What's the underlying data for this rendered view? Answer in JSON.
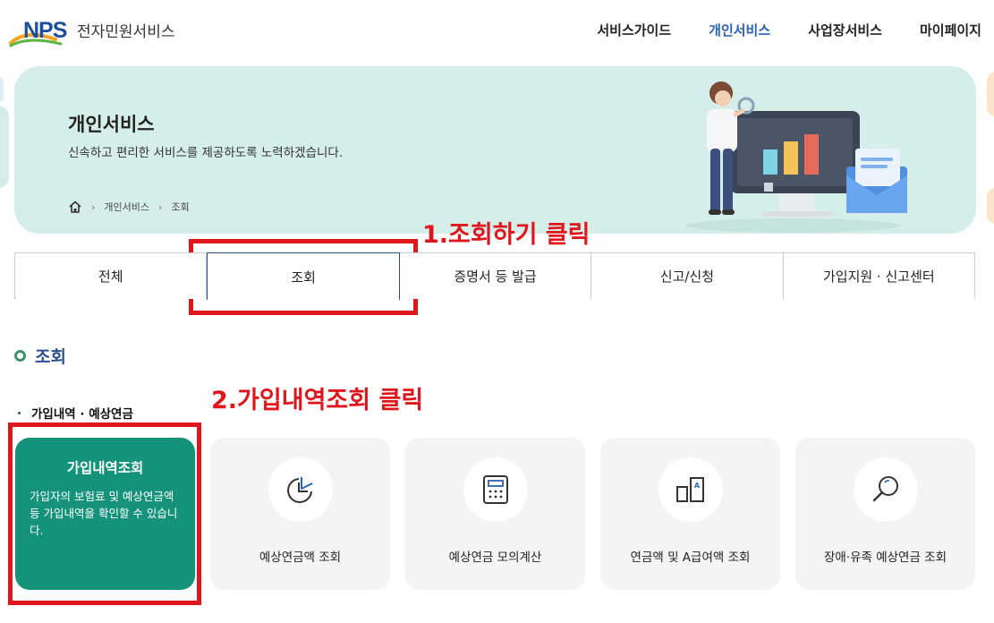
{
  "header": {
    "logo_text": "NPS",
    "site_name": "전자민원서비스",
    "nav": [
      {
        "label": "서비스가이드"
      },
      {
        "label": "개인서비스"
      },
      {
        "label": "사업장서비스"
      },
      {
        "label": "마이페이지"
      }
    ]
  },
  "banner": {
    "title": "개인서비스",
    "subtitle": "신속하고 편리한 서비스를 제공하도록 노력하겠습니다.",
    "breadcrumb": [
      "개인서비스",
      "조회"
    ]
  },
  "annotations": {
    "step1": "1.조회하기 클릭",
    "step2": "2.가입내역조회 클릭"
  },
  "tabs": [
    {
      "label": "전체"
    },
    {
      "label": "조회"
    },
    {
      "label": "증명서 등 발급"
    },
    {
      "label": "신고/신청"
    },
    {
      "label": "가입지원 · 신고센터"
    }
  ],
  "section": {
    "title": "조회",
    "subsection": "가입내역 · 예상연금"
  },
  "cards": {
    "featured": {
      "title": "가입내역조회",
      "desc": "가입자의 보험료 및 예상연금액 등 가입내역을 확인할 수 있습니다."
    },
    "items": [
      {
        "label": "예상연금액 조회",
        "icon": "pie-chart-icon"
      },
      {
        "label": "예상연금 모의계산",
        "icon": "calculator-icon"
      },
      {
        "label": "연금액 및 A급여액 조회",
        "icon": "document-a-icon"
      },
      {
        "label": "장애·유족 예상연금 조회",
        "icon": "magnifier-icon"
      }
    ]
  },
  "colors": {
    "brand_blue": "#2a62b4",
    "banner_bg": "#d6eeea",
    "featured_card": "#14937a",
    "annotation_red": "#e0161d"
  }
}
